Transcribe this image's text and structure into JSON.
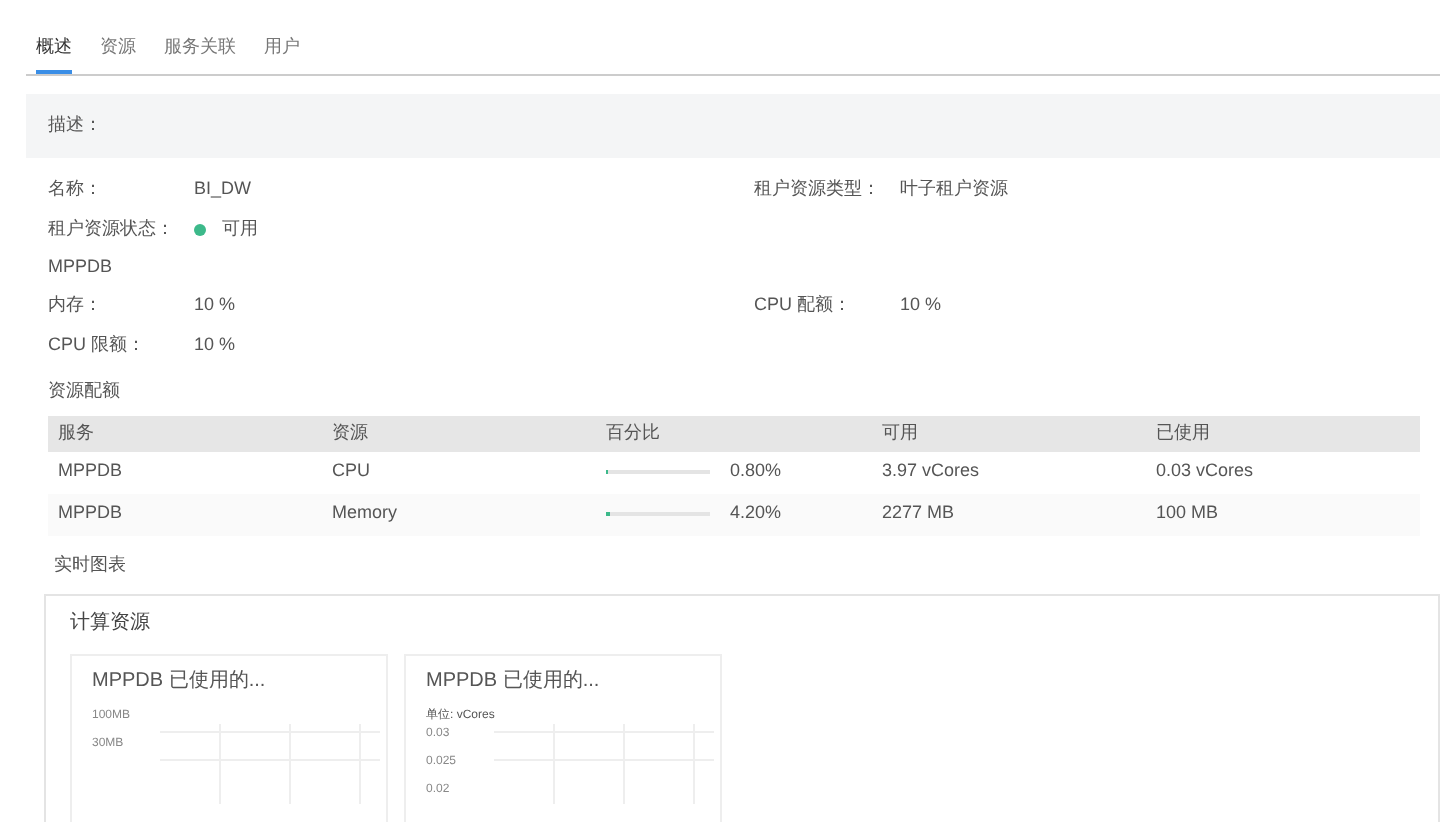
{
  "tabs": [
    {
      "label": "概述",
      "selected": true
    },
    {
      "label": "资源",
      "selected": false
    },
    {
      "label": "服务关联",
      "selected": false
    },
    {
      "label": "用户",
      "selected": false
    }
  ],
  "description": {
    "label": "描述："
  },
  "fields": [
    {
      "label": "名称：",
      "value": "BI_DW"
    },
    {
      "label": "租户资源类型：",
      "value": "叶子租户资源"
    },
    {
      "label": "租户资源状态：",
      "value": "可用",
      "color": "#3cb98a"
    }
  ],
  "service_name": "MPPDB",
  "quota_fields": [
    {
      "label": "内存：",
      "value": "10 %"
    },
    {
      "label": "CPU 配额：",
      "value": "10 %"
    },
    {
      "label": "CPU 限额：",
      "value": "10 %"
    }
  ],
  "allocation": {
    "title": "资源配额",
    "columns": [
      "服务",
      "资源",
      "百分比",
      "可用",
      "已使用"
    ],
    "rows": [
      {
        "service": "MPPDB",
        "resource": "CPU",
        "level": 0.008,
        "percent": "0.80%",
        "available": "3.97 vCores",
        "used": "0.03 vCores"
      },
      {
        "service": "MPPDB",
        "resource": "Memory",
        "level": 0.042,
        "percent": "4.20%",
        "available": "2277 MB",
        "used": "100 MB"
      }
    ]
  },
  "realtime": {
    "title": "实时图表",
    "panel_title": "计算资源",
    "charts": [
      {
        "title": "MPPDB 已使用的...",
        "axis_labels": [
          "100MB",
          "30MB"
        ]
      },
      {
        "title": "MPPDB 已使用的...",
        "unit": "单位: vCores",
        "axis_labels": [
          "0.03",
          "0.025",
          "0.02"
        ]
      }
    ]
  }
}
